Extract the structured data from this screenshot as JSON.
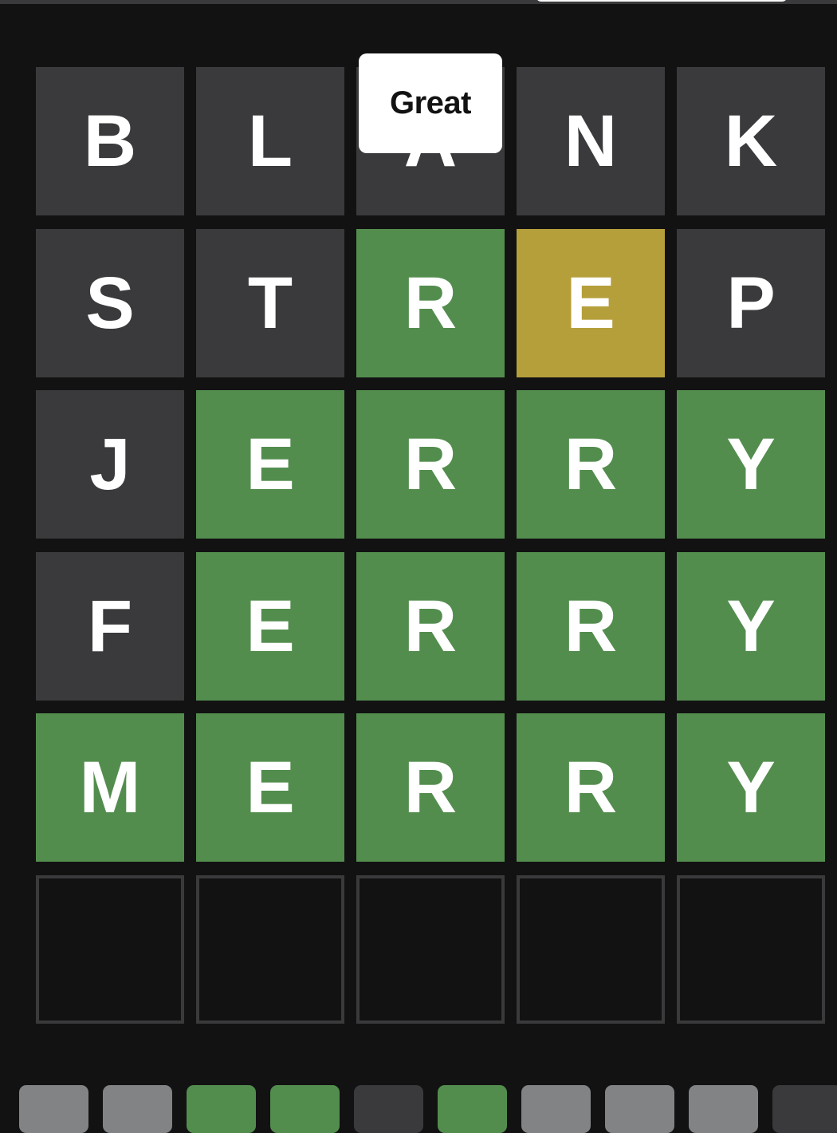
{
  "toast": {
    "message": "Great"
  },
  "board": {
    "rows": [
      {
        "tiles": [
          {
            "letter": "B",
            "state": "absent"
          },
          {
            "letter": "L",
            "state": "absent"
          },
          {
            "letter": "A",
            "state": "absent"
          },
          {
            "letter": "N",
            "state": "absent"
          },
          {
            "letter": "K",
            "state": "absent"
          }
        ]
      },
      {
        "tiles": [
          {
            "letter": "S",
            "state": "absent"
          },
          {
            "letter": "T",
            "state": "absent"
          },
          {
            "letter": "R",
            "state": "correct"
          },
          {
            "letter": "E",
            "state": "present"
          },
          {
            "letter": "P",
            "state": "absent"
          }
        ]
      },
      {
        "tiles": [
          {
            "letter": "J",
            "state": "absent"
          },
          {
            "letter": "E",
            "state": "correct"
          },
          {
            "letter": "R",
            "state": "correct"
          },
          {
            "letter": "R",
            "state": "correct"
          },
          {
            "letter": "Y",
            "state": "correct"
          }
        ]
      },
      {
        "tiles": [
          {
            "letter": "F",
            "state": "absent"
          },
          {
            "letter": "E",
            "state": "correct"
          },
          {
            "letter": "R",
            "state": "correct"
          },
          {
            "letter": "R",
            "state": "correct"
          },
          {
            "letter": "Y",
            "state": "correct"
          }
        ]
      },
      {
        "tiles": [
          {
            "letter": "M",
            "state": "correct"
          },
          {
            "letter": "E",
            "state": "correct"
          },
          {
            "letter": "R",
            "state": "correct"
          },
          {
            "letter": "R",
            "state": "correct"
          },
          {
            "letter": "Y",
            "state": "correct"
          }
        ]
      },
      {
        "tiles": [
          {
            "letter": "",
            "state": "empty"
          },
          {
            "letter": "",
            "state": "empty"
          },
          {
            "letter": "",
            "state": "empty"
          },
          {
            "letter": "",
            "state": "empty"
          },
          {
            "letter": "",
            "state": "empty"
          }
        ]
      }
    ]
  },
  "keyboard": {
    "top_row": [
      {
        "state": "unused"
      },
      {
        "state": "unused"
      },
      {
        "state": "correct"
      },
      {
        "state": "correct"
      },
      {
        "state": "absent"
      },
      {
        "state": "correct"
      },
      {
        "state": "unused"
      },
      {
        "state": "unused"
      },
      {
        "state": "unused"
      },
      {
        "state": "absent"
      }
    ]
  },
  "colors": {
    "background": "#121213",
    "absent": "#3a3a3c",
    "present": "#b59f3b",
    "correct": "#538d4e",
    "unused_key": "#818384",
    "toast_background": "#ffffff",
    "toast_text": "#121213"
  }
}
